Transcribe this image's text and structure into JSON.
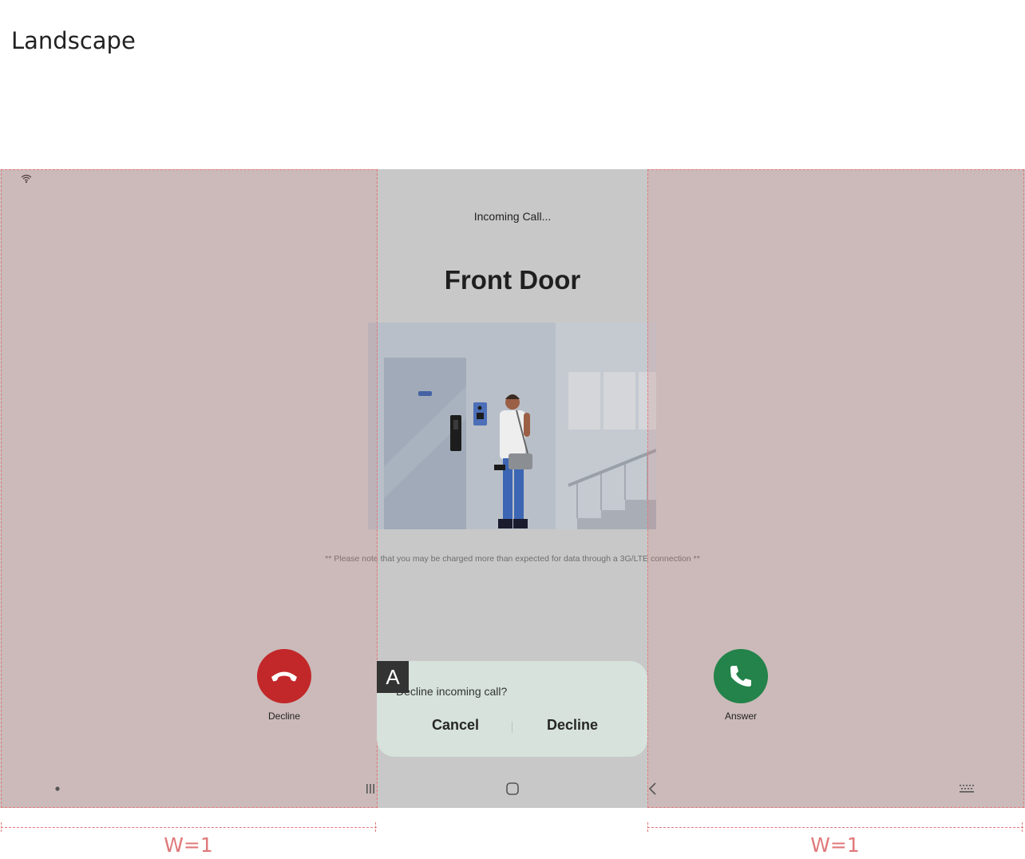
{
  "page": {
    "heading": "Landscape"
  },
  "status_bar": {
    "wifi_icon": "wifi-icon"
  },
  "call": {
    "status": "Incoming Call...",
    "caller": "Front Door",
    "illustration_icon": "doorbell-visitor-illustration",
    "data_note": "** Please note that you may be charged more than expected for data through a 3G/LTE connection **"
  },
  "buttons": {
    "decline": {
      "label": "Decline",
      "icon": "phone-hangup-icon",
      "color": "#c2282a"
    },
    "answer": {
      "label": "Answer",
      "icon": "phone-icon",
      "color": "#23834a"
    }
  },
  "dialog": {
    "message": "Decline incoming call?",
    "cancel_label": "Cancel",
    "decline_label": "Decline",
    "marker": "A"
  },
  "nav_bar": {
    "icons": [
      "dot-icon",
      "recent-apps-icon",
      "home-icon",
      "back-icon",
      "keyboard-icon"
    ]
  },
  "annotations": {
    "left_width_label": "W=1",
    "right_width_label": "W=1",
    "color": "#e0787a"
  }
}
